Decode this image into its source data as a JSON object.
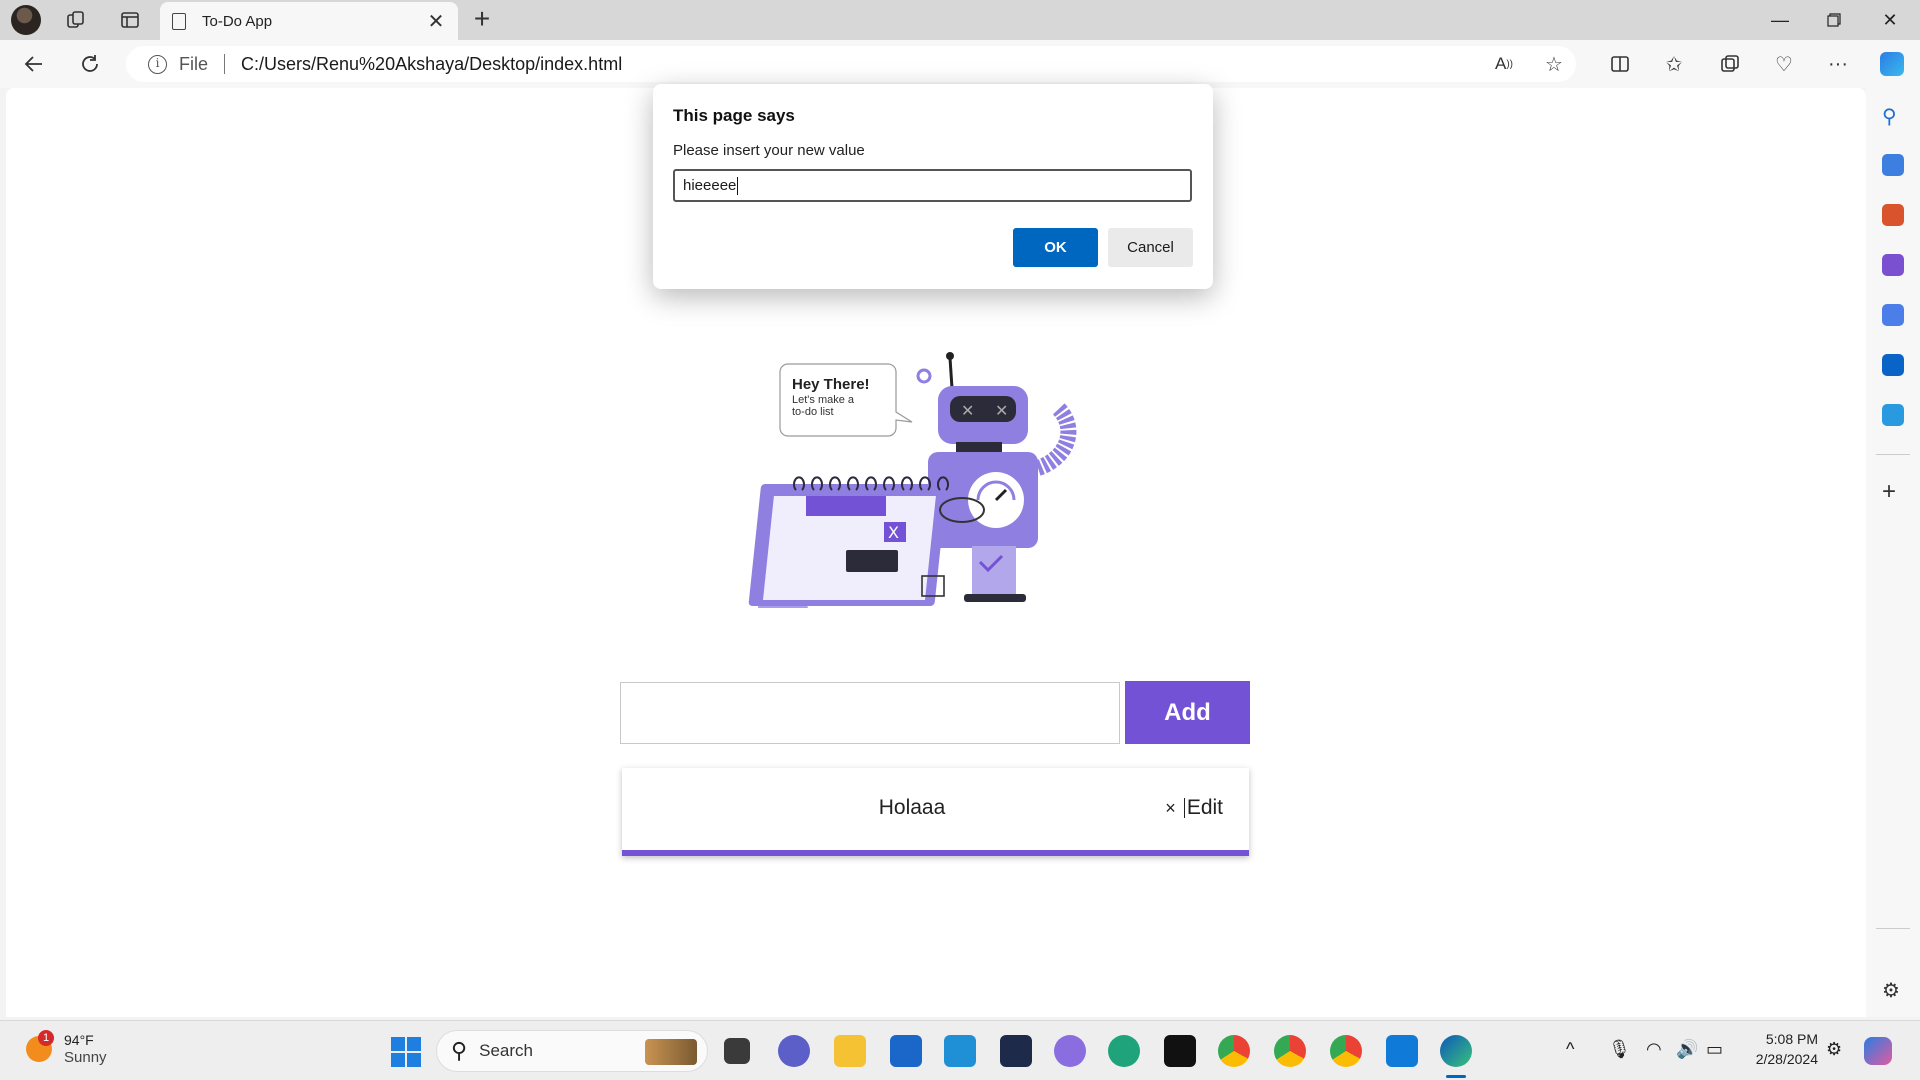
{
  "browser": {
    "tab_title": "To-Do App",
    "address_prefix": "File",
    "url": "C:/Users/Renu%20Akshaya/Desktop/index.html"
  },
  "dialog": {
    "title": "This page says",
    "message": "Please insert your new value",
    "input_value": "hieeeee",
    "ok_label": "OK",
    "cancel_label": "Cancel"
  },
  "page": {
    "illustration": {
      "bubble_title": "Hey There!",
      "bubble_line1": "Let's make a",
      "bubble_line2": "to-do list"
    },
    "input_value": "",
    "add_label": "Add",
    "todo_items": [
      {
        "text": "Holaaa",
        "delete_glyph": "×",
        "edit_label": "Edit"
      }
    ]
  },
  "taskbar": {
    "weather_badge": "1",
    "weather_temp": "94°F",
    "weather_condition": "Sunny",
    "search_label": "Search",
    "time": "5:08 PM",
    "date": "2/28/2024"
  },
  "colors": {
    "accent": "#7352d6",
    "dialog_ok": "#0067c0"
  }
}
